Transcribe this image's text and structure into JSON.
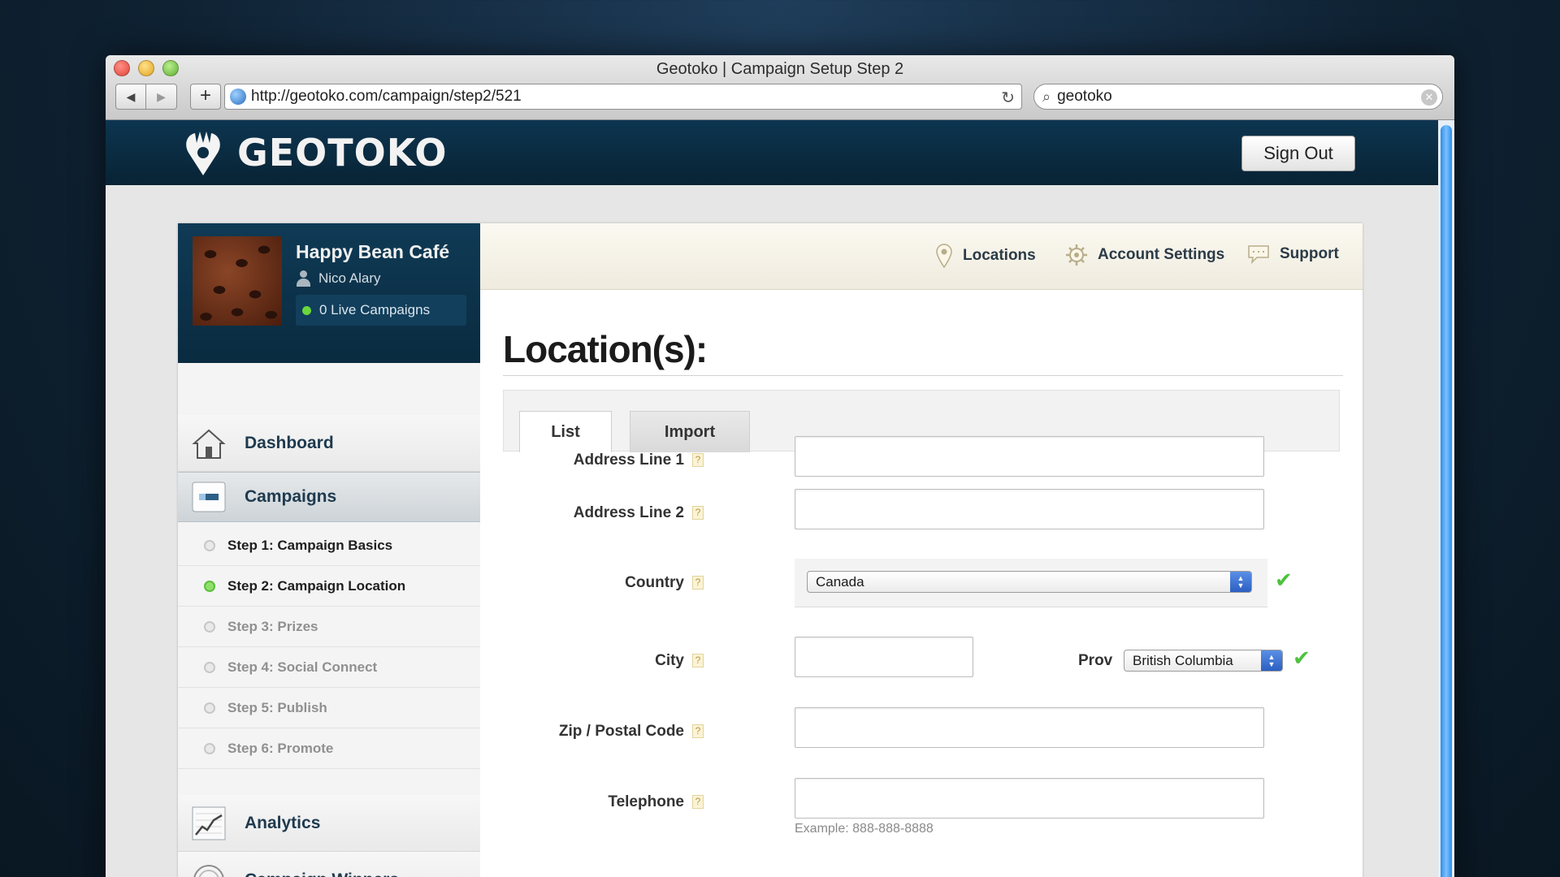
{
  "browser": {
    "window_title": "Geotoko | Campaign Setup Step 2",
    "url": "http://geotoko.com/campaign/step2/521",
    "search": "geotoko"
  },
  "header": {
    "logo_text": "GEOTOKO",
    "sign_out": "Sign Out"
  },
  "profile": {
    "business": "Happy Bean Café",
    "user": "Nico Alary",
    "live_campaigns": "0 Live Campaigns"
  },
  "sidebar": {
    "items": [
      {
        "label": "Dashboard",
        "icon": "house-icon"
      },
      {
        "label": "Campaigns",
        "icon": "campaign-card-icon"
      },
      {
        "label": "Analytics",
        "icon": "chart-icon"
      },
      {
        "label": "Campaign Winners",
        "icon": "medal-icon"
      }
    ],
    "steps": [
      {
        "label": "Step 1: Campaign Basics",
        "state": "done"
      },
      {
        "label": "Step 2: Campaign Location",
        "state": "current"
      },
      {
        "label": "Step 3: Prizes",
        "state": "todo"
      },
      {
        "label": "Step 4: Social Connect",
        "state": "todo"
      },
      {
        "label": "Step 5: Publish",
        "state": "todo"
      },
      {
        "label": "Step 6: Promote",
        "state": "todo"
      }
    ]
  },
  "topnav": {
    "locations": "Locations",
    "account_settings": "Account Settings",
    "support": "Support"
  },
  "main": {
    "title": "Location(s):",
    "tabs": [
      "List",
      "Import"
    ],
    "help_glyph": "?",
    "fields": {
      "address1": {
        "label": "Address Line 1",
        "value": ""
      },
      "address2": {
        "label": "Address Line 2",
        "value": ""
      },
      "country": {
        "label": "Country",
        "value": "Canada"
      },
      "city": {
        "label": "City",
        "value": ""
      },
      "prov": {
        "label": "Prov",
        "value": "British Columbia"
      },
      "zip": {
        "label": "Zip / Postal Code",
        "value": ""
      },
      "telephone": {
        "label": "Telephone",
        "value": "",
        "hint": "Example: 888-888-8888"
      }
    }
  },
  "colors": {
    "header_bg": "#0b2d43",
    "accent_green": "#4cc23c",
    "select_arrow_blue": "#2c5fc2"
  }
}
